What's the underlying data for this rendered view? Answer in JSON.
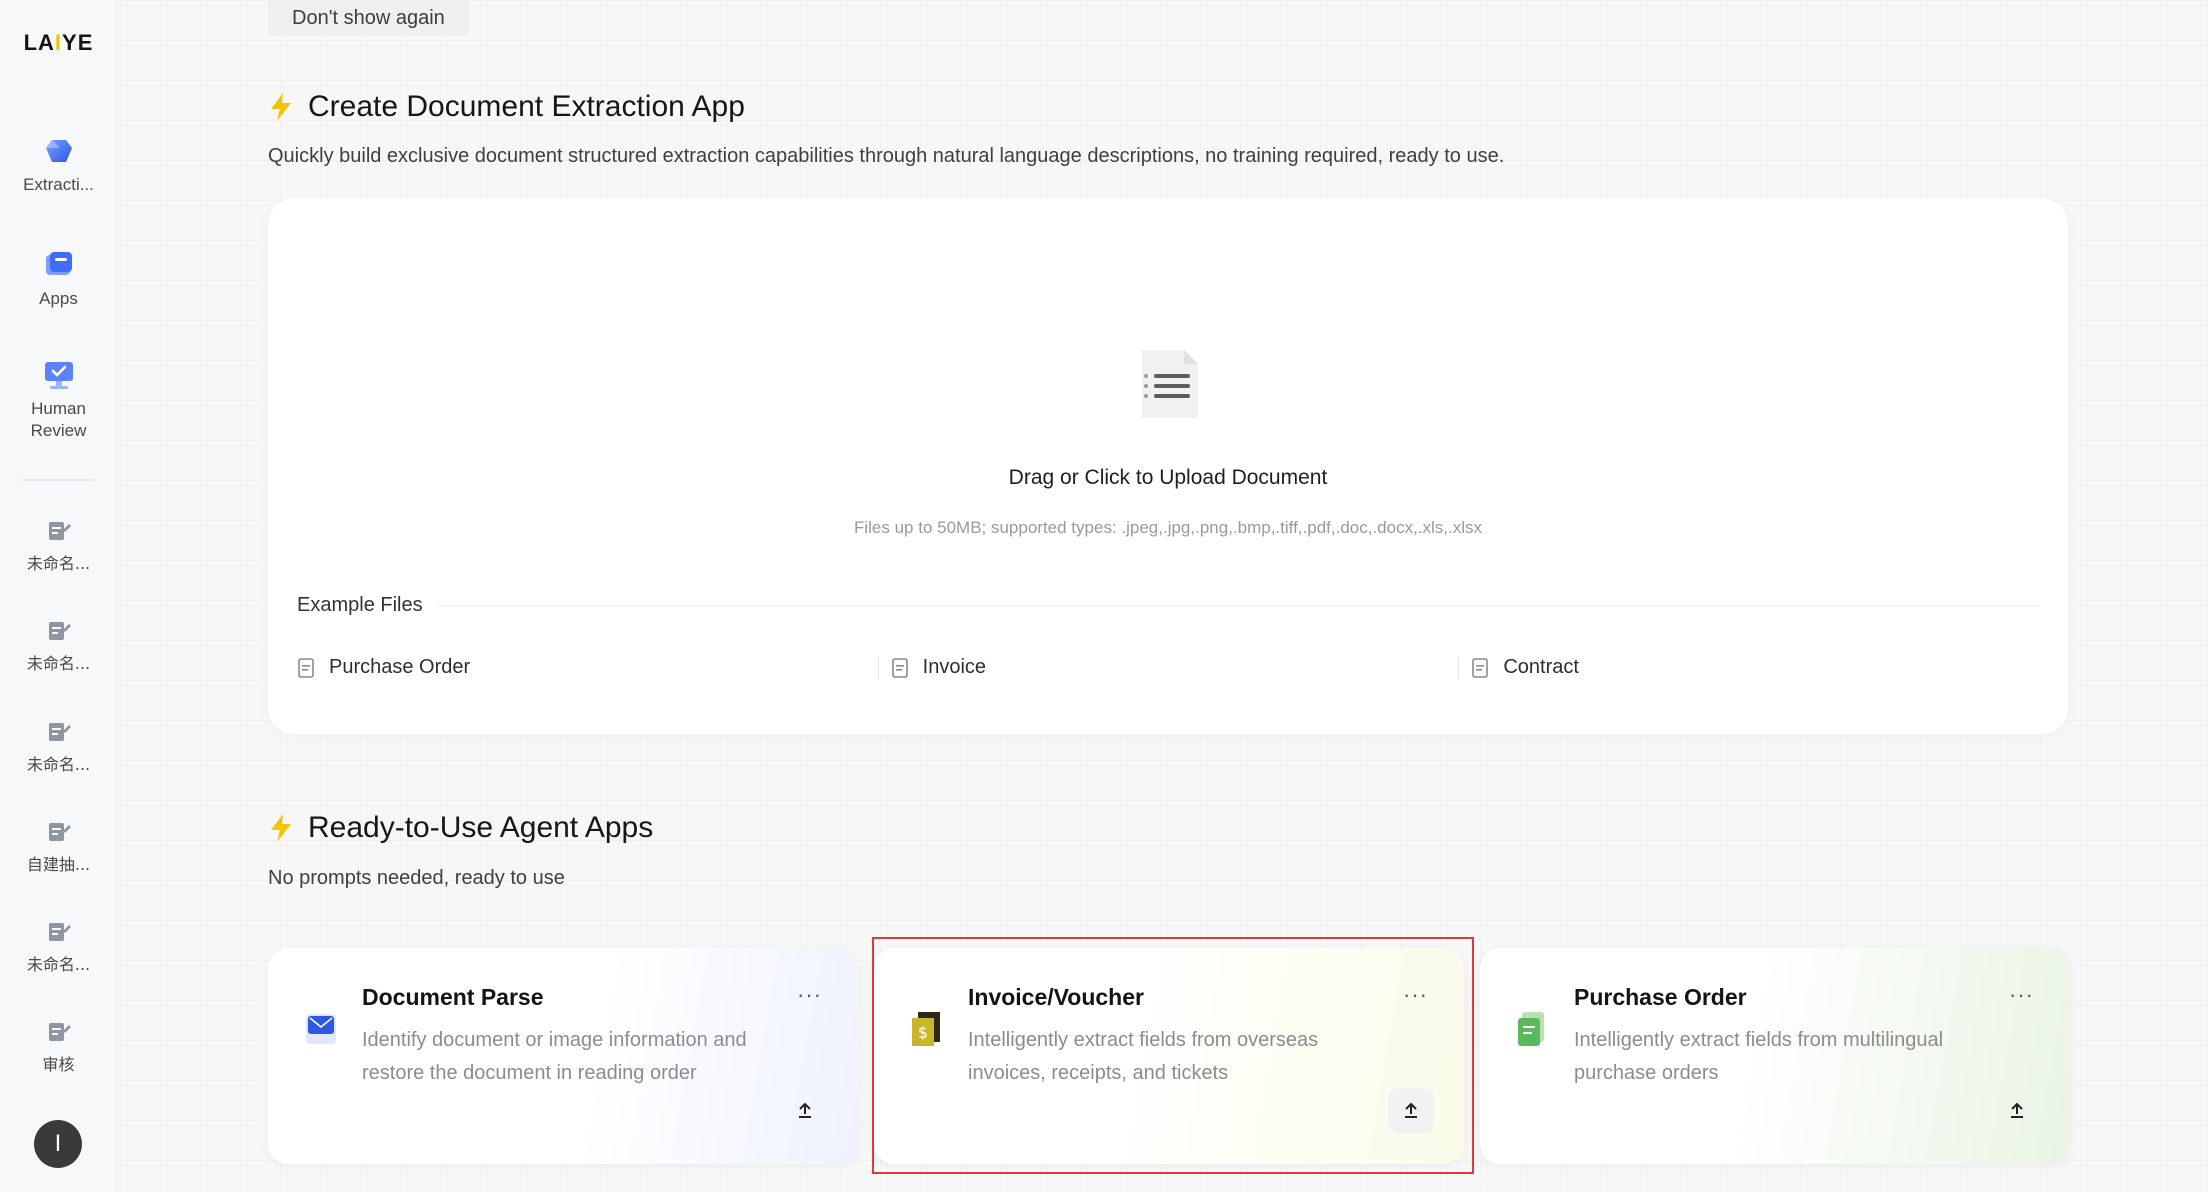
{
  "sidebar": {
    "logo": "LAIYE",
    "nav": [
      {
        "label": "Extracti...",
        "icon": "extraction-icon"
      },
      {
        "label": "Apps",
        "icon": "apps-icon"
      },
      {
        "label": "Human\nReview",
        "icon": "monitor-check-icon"
      }
    ],
    "docs": [
      {
        "label": "未命名..."
      },
      {
        "label": "未命名..."
      },
      {
        "label": "未命名..."
      },
      {
        "label": "自建抽..."
      },
      {
        "label": "未命名..."
      },
      {
        "label": "审核"
      }
    ],
    "avatar": "I"
  },
  "banner": {
    "dont_show": "Don't show again"
  },
  "create": {
    "title": "Create Document Extraction App",
    "subtitle": "Quickly build exclusive document structured extraction capabilities through natural language descriptions, no training required, ready to use.",
    "upload_title": "Drag or Click to Upload Document",
    "upload_hint": "Files up to 50MB; supported types: .jpeg,.jpg,.png,.bmp,.tiff,.pdf,.doc,.docx,.xls,.xlsx",
    "example_title": "Example Files",
    "examples": [
      "Purchase Order",
      "Invoice",
      "Contract"
    ]
  },
  "agents": {
    "title": "Ready-to-Use Agent Apps",
    "subtitle": "No prompts needed, ready to use",
    "cards": [
      {
        "title": "Document Parse",
        "desc": "Identify document or image information and restore the document in reading order"
      },
      {
        "title": "Invoice/Voucher",
        "desc": "Intelligently extract fields from overseas invoices, receipts, and tickets"
      },
      {
        "title": "Purchase Order",
        "desc": "Intelligently extract fields from multilingual purchase orders"
      }
    ],
    "more": "···"
  },
  "colors": {
    "accent": "#f5c400",
    "highlight": "#e0383e",
    "nav_blue": "#3d6ef5"
  }
}
